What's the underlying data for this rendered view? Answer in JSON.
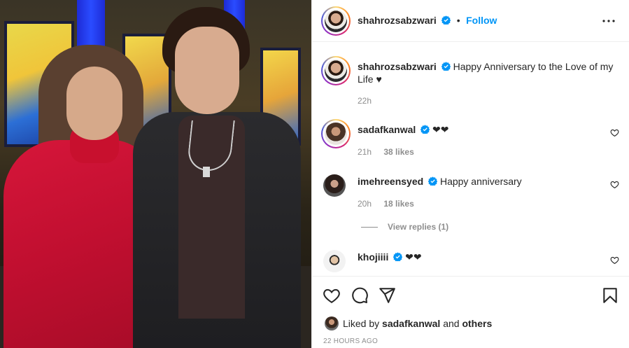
{
  "post": {
    "author": "shahrozsabzwari",
    "follow_label": "Follow",
    "caption": "Happy Anniversary to the Love of my Life ♥",
    "caption_time": "22h",
    "liked_prefix": "Liked by",
    "liked_user": "sadafkanwal",
    "liked_and": "and",
    "liked_others": "others",
    "timestamp": "22 HOURS AGO"
  },
  "comments": [
    {
      "user": "sadafkanwal",
      "text": "❤❤",
      "time": "21h",
      "likes": "38 likes"
    },
    {
      "user": "imehreensyed",
      "text": "Happy anniversary",
      "time": "20h",
      "likes": "18 likes"
    },
    {
      "user": "khojiiii",
      "text": "❤❤"
    }
  ],
  "view_replies": "View replies (1)",
  "colors": {
    "accent": "#0095f6",
    "verified": "#0095f6",
    "text": "#262626",
    "muted": "#8e8e8e"
  },
  "icons": {
    "more": "more-options-icon",
    "like": "heart-icon",
    "comment": "comment-icon",
    "share": "share-icon",
    "save": "bookmark-icon",
    "verified": "verified-badge-icon"
  }
}
